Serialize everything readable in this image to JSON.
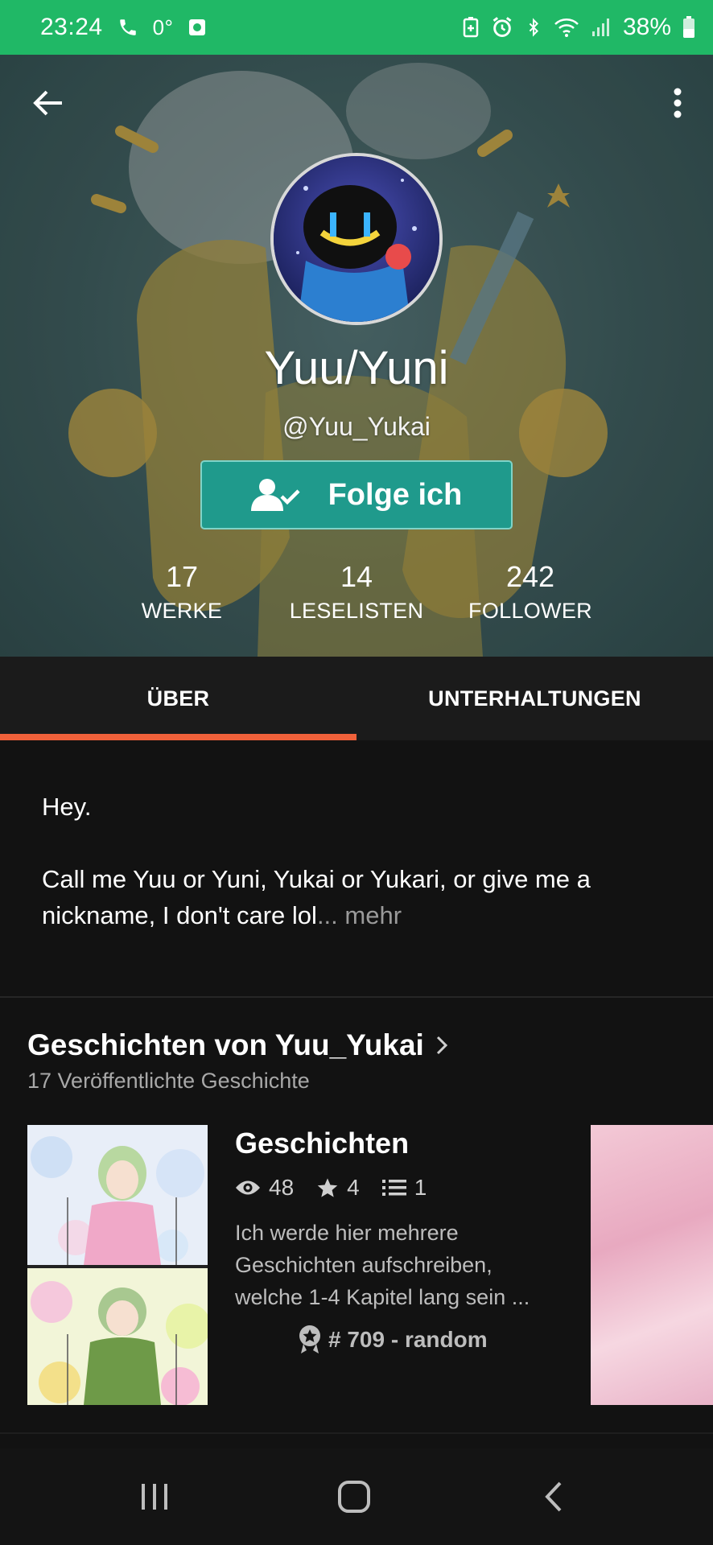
{
  "status_bar": {
    "time": "23:24",
    "temperature": "0°",
    "battery": "38%"
  },
  "profile": {
    "display_name": "Yuu/Yuni",
    "handle": "@Yuu_Yukai",
    "follow_label": "Folge ich"
  },
  "stats": [
    {
      "value": "17",
      "label": "WERKE"
    },
    {
      "value": "14",
      "label": "LESELISTEN"
    },
    {
      "value": "242",
      "label": "FOLLOWER"
    }
  ],
  "tabs": [
    {
      "label": "ÜBER",
      "active": true
    },
    {
      "label": "UNTERHALTUNGEN",
      "active": false
    }
  ],
  "about": {
    "line1": "Hey.",
    "line2": "Call me Yuu or Yuni, Yukai or Yukari, or give me a nickname, I don't care lol",
    "more": "... mehr"
  },
  "stories": {
    "title": "Geschichten von Yuu_Yukai",
    "subtitle": "17 Veröffentlichte Geschichte",
    "items": [
      {
        "title": "Geschichten",
        "reads": "48",
        "votes": "4",
        "parts": "1",
        "description": "Ich werde hier mehrere Geschichten aufschreiben, welche 1-4 Kapitel lang sein ...",
        "rank": "# 709 - random"
      }
    ]
  },
  "colors": {
    "status_bar": "#20b866",
    "follow_button": "#1f9a8c",
    "tab_indicator": "#f0613a",
    "background": "#121212"
  }
}
